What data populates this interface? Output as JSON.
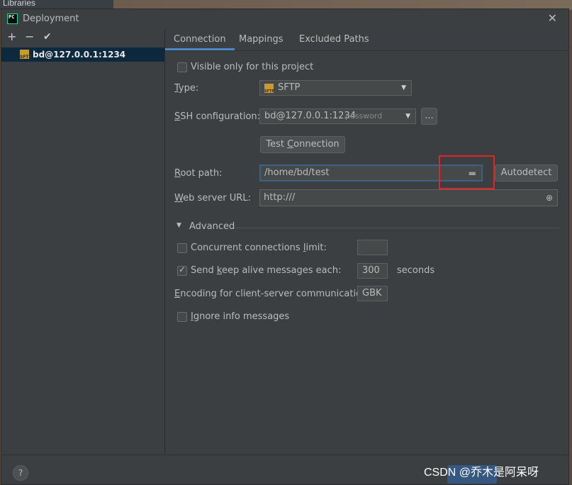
{
  "background": {
    "libraries_label": "Libraries"
  },
  "window": {
    "title": "Deployment",
    "app_icon_text": "PC",
    "close_glyph": "✕"
  },
  "toolbar": {
    "add": "+",
    "remove": "−",
    "apply": "✔"
  },
  "servers": [
    {
      "label": "bd@127.0.0.1:1234",
      "icon_text": "SFTP"
    }
  ],
  "tabs": [
    "Connection",
    "Mappings",
    "Excluded Paths"
  ],
  "connection": {
    "visible_only": {
      "label": "Visible only for this project",
      "checked": false
    },
    "type": {
      "label_u": "T",
      "label_rest": "ype:",
      "value": "SFTP",
      "icon_text": "SFTP"
    },
    "ssh": {
      "label_u": "S",
      "label_rest": "SH configuration:",
      "value": "bd@127.0.0.1:1234",
      "hint": "password",
      "browse": "..."
    },
    "test_connection": {
      "pre": "Test ",
      "u": "C",
      "post": "onnection"
    },
    "root_path": {
      "label_u": "R",
      "label_rest": "oot path:",
      "value": "/home/bd/test",
      "autodetect": "Autodetect"
    },
    "web_server": {
      "label_u": "W",
      "label_rest": "eb server URL:",
      "value": "http:///"
    }
  },
  "advanced": {
    "header": "Advanced",
    "concurrent": {
      "pre": "Concurrent connections ",
      "u": "l",
      "post": "imit:",
      "value": "",
      "checked": false
    },
    "keep_alive": {
      "pre": "Send ",
      "u": "k",
      "post": "eep alive messages each:",
      "value": "300",
      "unit": "seconds",
      "checked": true
    },
    "encoding": {
      "label_u": "E",
      "label_rest": "ncoding for client-server communication:",
      "value": "GBK"
    },
    "ignore_info": {
      "pre": "",
      "u": "I",
      "post": "gnore info messages",
      "checked": false
    }
  },
  "footer": {
    "help": "?"
  },
  "watermark": "CSDN @乔木是阿呆呀",
  "colors": {
    "accent": "#4a88c7",
    "selection": "#0d293e",
    "highlight_box": "#e32424",
    "background": "#3c3f41"
  }
}
